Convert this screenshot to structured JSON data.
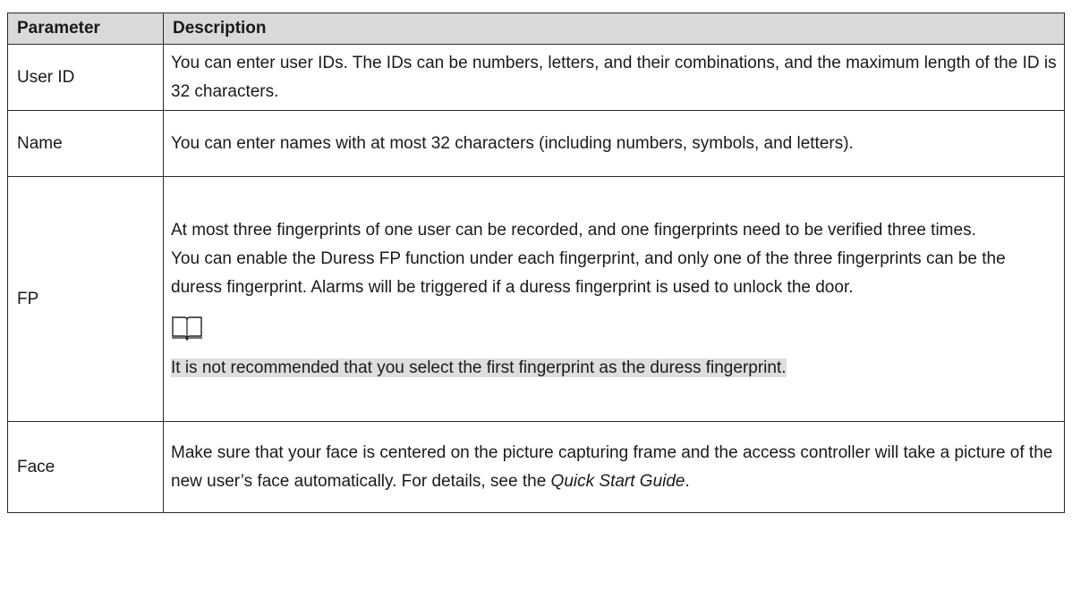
{
  "table": {
    "headers": [
      "Parameter",
      "Description"
    ],
    "rows": [
      {
        "param": "User ID",
        "desc": "You can enter user IDs. The IDs can be numbers, letters, and their combinations, and the maximum length of the ID is 32 characters."
      },
      {
        "param": "Name",
        "desc": "You can enter names with at most 32 characters (including numbers, symbols, and letters)."
      },
      {
        "param": "FP",
        "desc_p1": "At most three fingerprints of one user can be recorded, and one fingerprints need to be verified three times.",
        "desc_p2": "You can enable the Duress FP function under each fingerprint, and only one of the three fingerprints can be the duress fingerprint. Alarms will be triggered if a duress fingerprint is used to unlock the door.",
        "note_icon": "book-note-icon",
        "note": "It is not recommended that you select the first fingerprint as the duress fingerprint."
      },
      {
        "param": "Face",
        "desc_before": "Make sure that your face is centered on the picture capturing frame and the access controller will take a picture of the new user’s face automatically. For details, see the ",
        "desc_italic": "Quick Start Guide",
        "desc_after": "."
      }
    ]
  }
}
